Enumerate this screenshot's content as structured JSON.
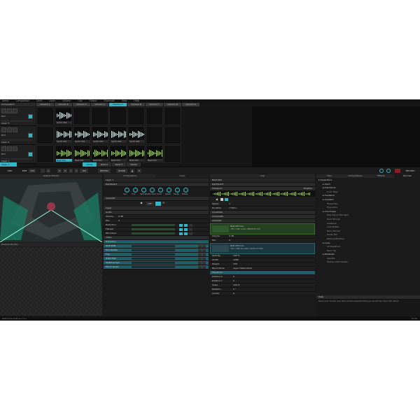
{
  "menubar": [
    "Arena",
    "Composition",
    "Deck",
    "Layer",
    "Column",
    "Clip",
    "Output",
    "Shortcuts",
    "View",
    "Help"
  ],
  "composition_label": "Composition",
  "layers": [
    {
      "name": "Layer 3",
      "clips": [
        "",
        "Synth 004",
        "",
        "",
        "",
        "",
        "",
        ""
      ]
    },
    {
      "name": "Layer 2",
      "clips": [
        "",
        "Synth 001",
        "Synth 002",
        "Synth 003",
        "Synth 004",
        "Synth 005",
        "",
        ""
      ]
    },
    {
      "name": "Layer 1",
      "clips": [
        "",
        "Beat 004",
        "Beat 001",
        "Beat 002",
        "Beat 003",
        "Beat 004",
        "Beat 005",
        ""
      ]
    }
  ],
  "columns": [
    "Column 1",
    "Column 2",
    "Column 3",
    "Column 4",
    "Column 5",
    "Column 6",
    "Column 7",
    "Column 8",
    "Column 9"
  ],
  "layer_row_label": "BAS",
  "deck_tabs": [
    "Arena",
    "Deck 2",
    "Deck 3",
    "Decks"
  ],
  "transport": {
    "link": "LINK",
    "bpm_label": "BPM",
    "bpm": "120",
    "tap": "TAP",
    "resync": "RESYNC",
    "pause": "PAUSE",
    "record": "RECORD"
  },
  "panels": {
    "output_monitor": "Output Monitor",
    "preview_monitor": "Preview Monitor",
    "composition": "Composition",
    "layer": "Layer",
    "clip": "Clip",
    "files": "Files",
    "compositions": "Compositions",
    "effects": "Effects",
    "sources": "Sources"
  },
  "layer_panel": {
    "layer_name": "Layer 1",
    "sections": [
      "Dashboard",
      "Autopilot",
      "Layer",
      "Audio"
    ],
    "knobs": [
      "Gain",
      "Hue",
      "Saturation",
      "Contrast",
      "Invert",
      "Speed",
      "Range",
      "Rotate"
    ],
    "volume_label": "Volume",
    "volume_value": "0 dB",
    "pan_label": "Pan",
    "pan_value": "0",
    "effects": [
      "Distortion",
      "Flanger",
      "Bitcrusher"
    ],
    "video_section": "Video",
    "transition": "Transition",
    "video_effects": [
      "Shift RGB",
      "Hue Rotate",
      "Fog",
      "Trails Fast",
      "Kaleidoscope",
      "Mirror Quad"
    ],
    "off_label": "OFF"
  },
  "clip_panel": {
    "clip_name": "Beat 004",
    "sections": [
      "Dashboard",
      "Transport",
      "Crossfade",
      "Composite",
      "Autopilot"
    ],
    "transport_mode": "Timeline",
    "speed_label": "Speed",
    "speed_value": "1",
    "duration_label": "Duration",
    "duration_value": "7.500 s",
    "clip_info_1": "Beat 004.mov",
    "clip_info_2": "720 x 480 Audio 48000Hz 2Ch",
    "volume_label": "Volume",
    "volume_value": "0 dB",
    "pan_label": "Pan",
    "pan_value": "0",
    "video_info_1": "Beat 004.mov",
    "video_info_2": "720 x 480 Duration 00:00:07.500",
    "opacity_label": "Opacity",
    "opacity_value": "100 %",
    "width_label": "Width",
    "width_value": "1080",
    "height_label": "Height",
    "height_value": "720",
    "blend_label": "Blend Mode",
    "blend_value": "Layer Determined",
    "transform": "Transform",
    "position_x_label": "Position X",
    "position_x_value": "0",
    "position_y_label": "Position Y",
    "position_y_value": "0",
    "scale_label": "Scale",
    "scale_value": "100 %",
    "rotation_label": "Rotation",
    "rotation_value": "0 °",
    "anchor_label": "Anchor",
    "anchor_value": "0"
  },
  "sources_tree": [
    {
      "label": "Generators",
      "level": 0
    },
    {
      "label": "Alarm",
      "level": 1
    },
    {
      "label": "Checkered",
      "level": 1
    },
    {
      "label": "Color Pass",
      "level": 2
    },
    {
      "label": "Feedback",
      "level": 1
    },
    {
      "label": "Gradient",
      "level": 1
    },
    {
      "label": "Hippie Sky",
      "level": 2
    },
    {
      "label": "Hypnotica",
      "level": 2
    },
    {
      "label": "Line Scape",
      "level": 1
    },
    {
      "label": "Dancing on the Spot",
      "level": 2
    },
    {
      "label": "Hard Strings",
      "level": 2
    },
    {
      "label": "Lissajous",
      "level": 2
    },
    {
      "label": "Line Mobile",
      "level": 2
    },
    {
      "label": "Neon Tunnel",
      "level": 2
    },
    {
      "label": "Radar Fan",
      "level": 2
    },
    {
      "label": "Waving Particles",
      "level": 2
    },
    {
      "label": "Lines",
      "level": 1
    },
    {
      "label": "All Dayaliner",
      "level": 2
    },
    {
      "label": "Neon Up",
      "level": 2
    },
    {
      "label": "Metaballs",
      "level": 1
    },
    {
      "label": "Sparkle",
      "level": 2
    },
    {
      "label": "Plasma Alternatives",
      "level": 2
    }
  ],
  "help": {
    "title": "Help",
    "text": "Move your mouse over the interface element that you would like more info about."
  },
  "status": {
    "left": "Resolume Avenue 7.x.x",
    "right": "12:44"
  },
  "accent": "#36b4c6"
}
